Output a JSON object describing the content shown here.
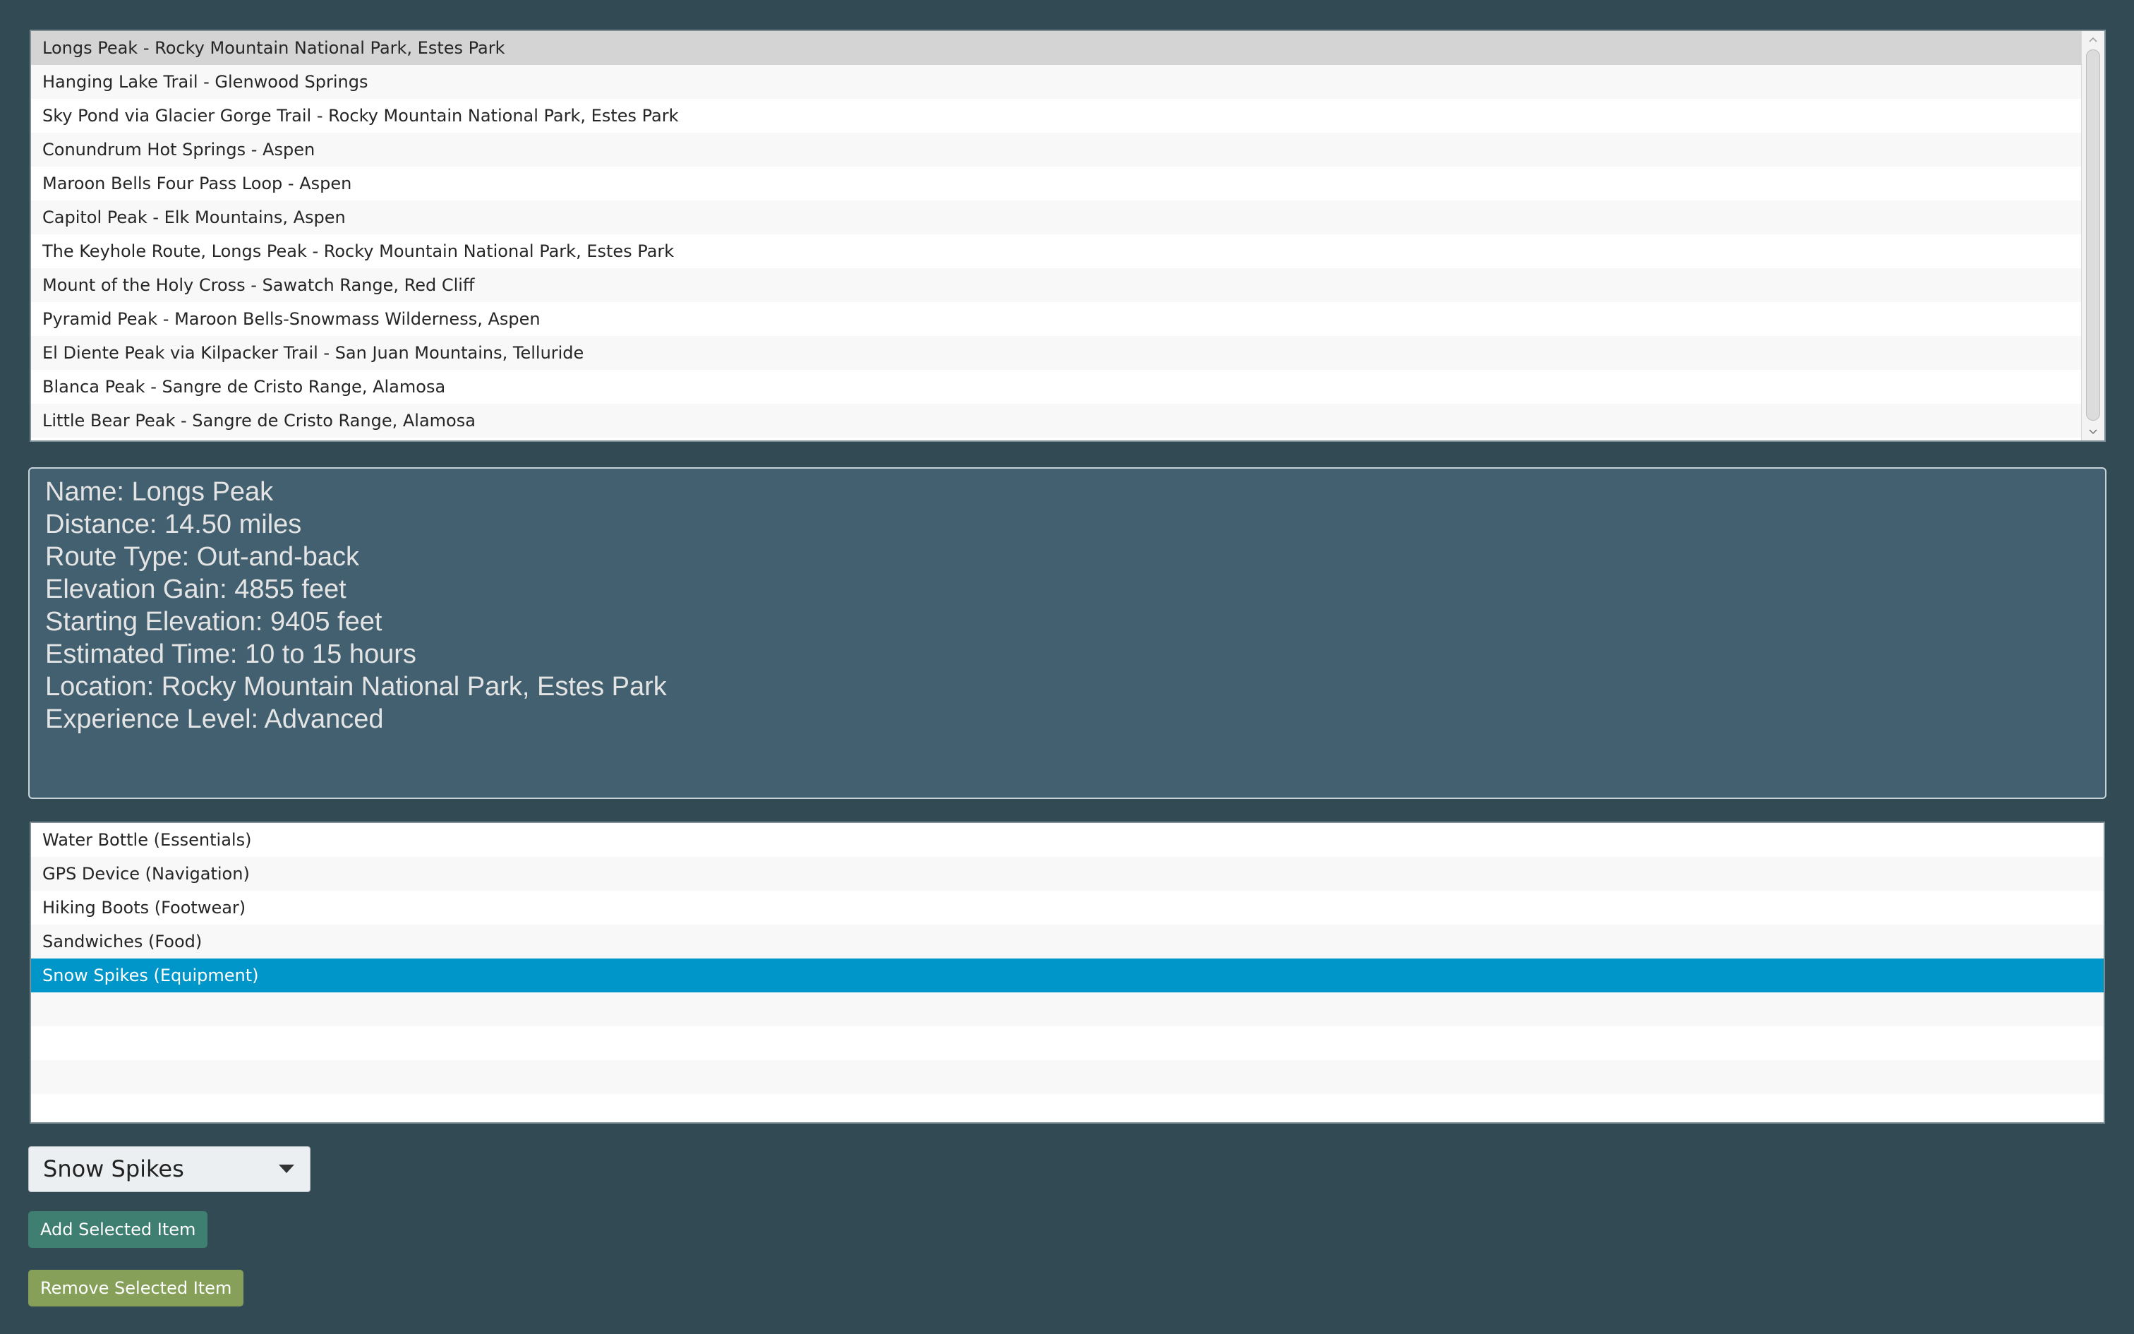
{
  "trails": {
    "selected_index": 0,
    "items": [
      "Longs Peak - Rocky Mountain National Park, Estes Park",
      "Hanging Lake Trail - Glenwood Springs",
      "Sky Pond via Glacier Gorge Trail - Rocky Mountain National Park, Estes Park",
      "Conundrum Hot Springs - Aspen",
      "Maroon Bells Four Pass Loop - Aspen",
      "Capitol Peak - Elk Mountains, Aspen",
      "The Keyhole Route, Longs Peak - Rocky Mountain National Park, Estes Park",
      "Mount of the Holy Cross - Sawatch Range, Red Cliff",
      "Pyramid Peak - Maroon Bells-Snowmass Wilderness, Aspen",
      "El Diente Peak via Kilpacker Trail - San Juan Mountains, Telluride",
      "Blanca Peak - Sangre de Cristo Range, Alamosa",
      "Little Bear Peak - Sangre de Cristo Range, Alamosa"
    ]
  },
  "details": {
    "name": "Name: Longs Peak",
    "distance": "Distance: 14.50 miles",
    "route_type": "Route Type: Out-and-back",
    "elevation_gain": "Elevation Gain: 4855 feet",
    "starting_elevation": "Starting Elevation: 9405 feet",
    "estimated_time": "Estimated Time: 10 to 15 hours",
    "location": "Location: Rocky Mountain National Park, Estes Park",
    "experience_level": "Experience Level: Advanced"
  },
  "gear": {
    "selected_index": 4,
    "empty_rows": 4,
    "items": [
      "Water Bottle (Essentials)",
      "GPS Device (Navigation)",
      "Hiking Boots (Footwear)",
      "Sandwiches (Food)",
      "Snow Spikes (Equipment)"
    ]
  },
  "controls": {
    "select_value": "Snow Spikes",
    "add_label": "Add Selected Item",
    "remove_label": "Remove Selected Item"
  },
  "colors": {
    "background": "#324a53",
    "details_panel": "#426070",
    "selection_blue": "#0096c9",
    "add_button": "#3e7f72",
    "remove_button": "#86a05a"
  }
}
